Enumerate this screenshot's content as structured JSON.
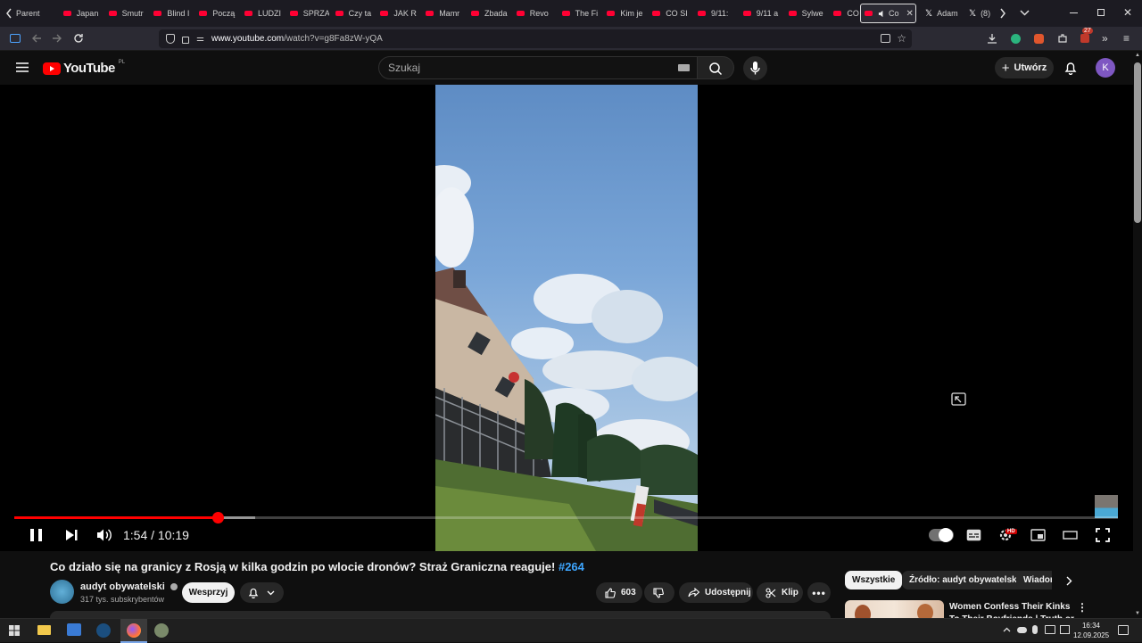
{
  "browser": {
    "tabs": [
      {
        "label": "Parent",
        "has_icon": false
      },
      {
        "label": "Japan",
        "has_icon": true
      },
      {
        "label": "Smutr",
        "has_icon": true
      },
      {
        "label": "Blind I",
        "has_icon": true
      },
      {
        "label": "Począ",
        "has_icon": true
      },
      {
        "label": "LUDZI",
        "has_icon": true
      },
      {
        "label": "SPRZA",
        "has_icon": true
      },
      {
        "label": "Czy ta",
        "has_icon": true
      },
      {
        "label": "JAK R",
        "has_icon": true
      },
      {
        "label": "Mamr",
        "has_icon": true
      },
      {
        "label": "Zbada",
        "has_icon": true
      },
      {
        "label": "Revo",
        "has_icon": true
      },
      {
        "label": "The Fi",
        "has_icon": true
      },
      {
        "label": "Kim je",
        "has_icon": true
      },
      {
        "label": "CO SI",
        "has_icon": true
      },
      {
        "label": "9/11:",
        "has_icon": true
      },
      {
        "label": "9/11 a",
        "has_icon": true
      },
      {
        "label": "Sylwe",
        "has_icon": true
      },
      {
        "label": "CO SI",
        "has_icon": true
      }
    ],
    "active_tab": {
      "label": "Co"
    },
    "extra_tabs": [
      {
        "label": "Adam"
      },
      {
        "label": "(8)"
      }
    ],
    "url_host": "www.youtube.com",
    "url_path": "/watch?v=g8Fa8zW-yQA",
    "extension_badge": "27"
  },
  "youtube": {
    "logo_text": "YouTube",
    "region": "PL",
    "search_placeholder": "Szukaj",
    "create_label": "Utwórz",
    "avatar_letter": "K"
  },
  "player": {
    "current_time": "1:54",
    "duration": "10:19",
    "played_fraction": 0.184,
    "buffered_fraction": 0.218,
    "hd_badge": "HD"
  },
  "video": {
    "title": "Co działo się na granicy z Rosją w kilka godzin po wlocie dronów? Straż Graniczna reaguje!",
    "hashtag": "#264",
    "channel_name": "audyt obywatelski",
    "subscribers": "317 tys. subskrybentów",
    "support_label": "Wesprzyj",
    "likes": "603",
    "share_label": "Udostępnij",
    "clip_label": "Klip"
  },
  "sidebar": {
    "chips": [
      "Wszystkie",
      "Źródło: audyt obywatelski",
      "Wiadom"
    ],
    "reco_title": "Women Confess Their Kinks To Their Boyfriends | Truth or Dri"
  },
  "taskbar": {
    "time": "16:34",
    "date": "12.09.2025"
  },
  "colors": {
    "accent_red": "#ff0000",
    "link_blue": "#3ea6ff",
    "avatar_purple": "#7e57c2"
  }
}
